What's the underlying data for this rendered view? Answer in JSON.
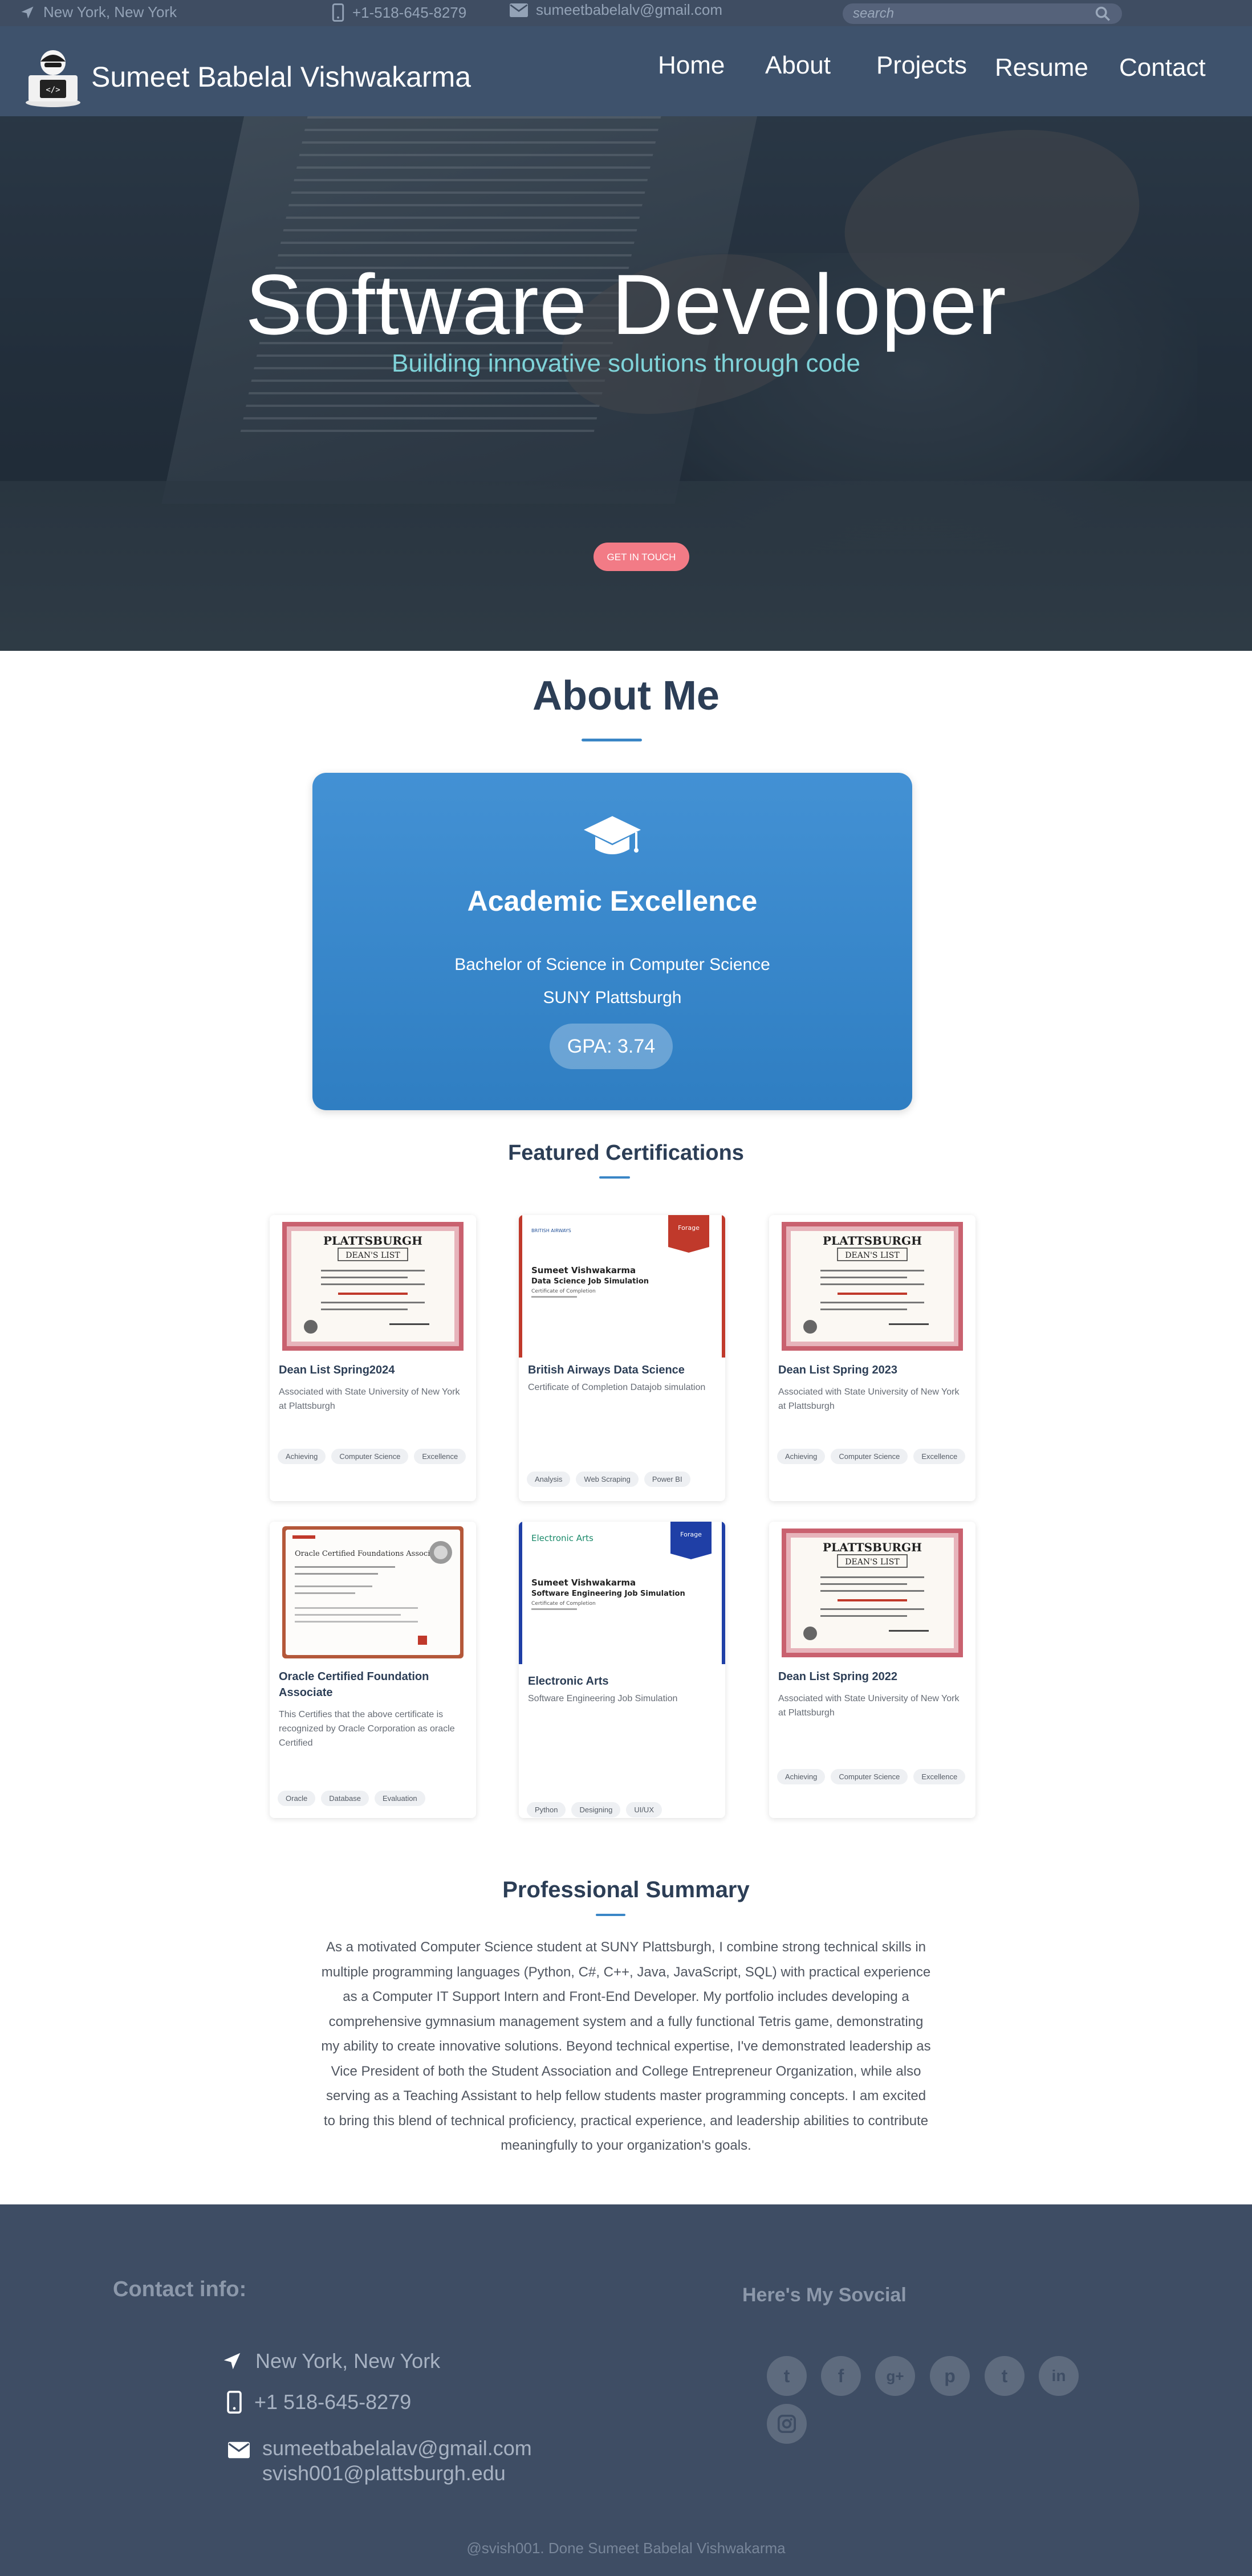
{
  "topbar": {
    "location": "New York, New York",
    "phone": "+1-518-645-8279",
    "email": "sumeetbabelalv@gmail.com",
    "search_placeholder": "search"
  },
  "nav": {
    "brand": "Sumeet Babelal Vishwakarma",
    "links": [
      "Home",
      "About",
      "Projects",
      "Resume",
      "Contact"
    ]
  },
  "hero": {
    "title": "Software Developer",
    "subtitle": "Building innovative solutions through code",
    "cta": "GET IN TOUCH"
  },
  "about": {
    "heading": "About Me",
    "card": {
      "title": "Academic Excellence",
      "degree": "Bachelor of Science in Computer Science",
      "school": "SUNY Plattsburgh",
      "gpa": "GPA: 3.74"
    }
  },
  "certifications": {
    "heading": "Featured Certifications",
    "items": [
      {
        "title": "Dean List Spring2024",
        "desc": "Associated with State University of New York at Plattsburgh",
        "tags": [
          "Achieving",
          "Computer Science",
          "Excellence"
        ],
        "image": "deans-list-certificate"
      },
      {
        "title": "British Airways Data Science",
        "desc": "Certificate of Completion Datajob simulation",
        "tags": [
          "Analysis",
          "Web Scraping",
          "Power BI"
        ],
        "image": "forage-certificate",
        "img_text": {
          "company": "BRITISH AIRWAYS",
          "name": "Sumeet Vishwakarma",
          "program": "Data Science Job Simulation",
          "sub": "Certificate of Completion",
          "badge": "Forage"
        }
      },
      {
        "title": "Dean List Spring 2023",
        "desc": "Associated with State University of New York at Plattsburgh",
        "tags": [
          "Achieving",
          "Computer Science",
          "Excellence"
        ],
        "image": "deans-list-certificate"
      },
      {
        "title": "Oracle Certified Foundation Associate",
        "desc": "This Certifies that the above certificate is recognized by Oracle Corporation as oracle Certified",
        "tags": [
          "Oracle",
          "Database",
          "Evaluation"
        ],
        "image": "oracle-certificate",
        "img_text": {
          "heading": "Oracle Certified Foundations Associate"
        }
      },
      {
        "title": "Electronic Arts",
        "desc": "Software Engineering Job Simulation",
        "tags": [
          "Python",
          "Designing",
          "UI/UX"
        ],
        "image": "forage-certificate",
        "img_text": {
          "company": "Electronic Arts",
          "name": "Sumeet Vishwakarma",
          "program": "Software Engineering Job Simulation",
          "sub": "Certificate of Completion",
          "badge": "Forage"
        }
      },
      {
        "title": "Dean List Spring 2022",
        "desc": "Associated with State University of New York at Plattsburgh",
        "tags": [
          "Achieving",
          "Computer Science",
          "Excellence"
        ],
        "image": "deans-list-certificate"
      }
    ],
    "deans_list_text": {
      "plattsburgh": "PLATTSBURGH",
      "deans": "DEAN'S LIST"
    }
  },
  "summary": {
    "heading": "Professional Summary",
    "text": "As a motivated Computer Science student at SUNY Plattsburgh, I combine strong technical skills in multiple programming languages (Python, C#, C++, Java, JavaScript, SQL) with practical experience as a Computer IT Support Intern and Front-End Developer. My portfolio includes developing a comprehensive gymnasium management system and a fully functional Tetris game, demonstrating my ability to create innovative solutions. Beyond technical expertise, I've demonstrated leadership as Vice President of both the Student Association and College Entrepreneur Organization, while also serving as a Teaching Assistant to help fellow students master programming concepts. I am excited to bring this blend of technical proficiency, practical experience, and leadership abilities to contribute meaningfully to your organization's goals."
  },
  "footer": {
    "contact_heading": "Contact info:",
    "location": "New York, New York",
    "phone": "+1 518-645-8279",
    "email1": "sumeetbabelalav@gmail.com",
    "email2": "svish001@plattsburgh.edu",
    "social_heading": "Here's My Sovcial",
    "social_icons": [
      "twitter-icon",
      "facebook-icon",
      "google-plus-icon",
      "pinterest-icon",
      "tumblr-icon",
      "linkedin-icon",
      "instagram-icon"
    ],
    "credit": "@svish001. Done Sumeet Babelal Vishwakarma"
  },
  "colors": {
    "nav": "#3e526c",
    "topbar": "#3f4d62",
    "accent": "#3a86c6",
    "cta": "#f27b86",
    "footer": "#3e4d64"
  }
}
